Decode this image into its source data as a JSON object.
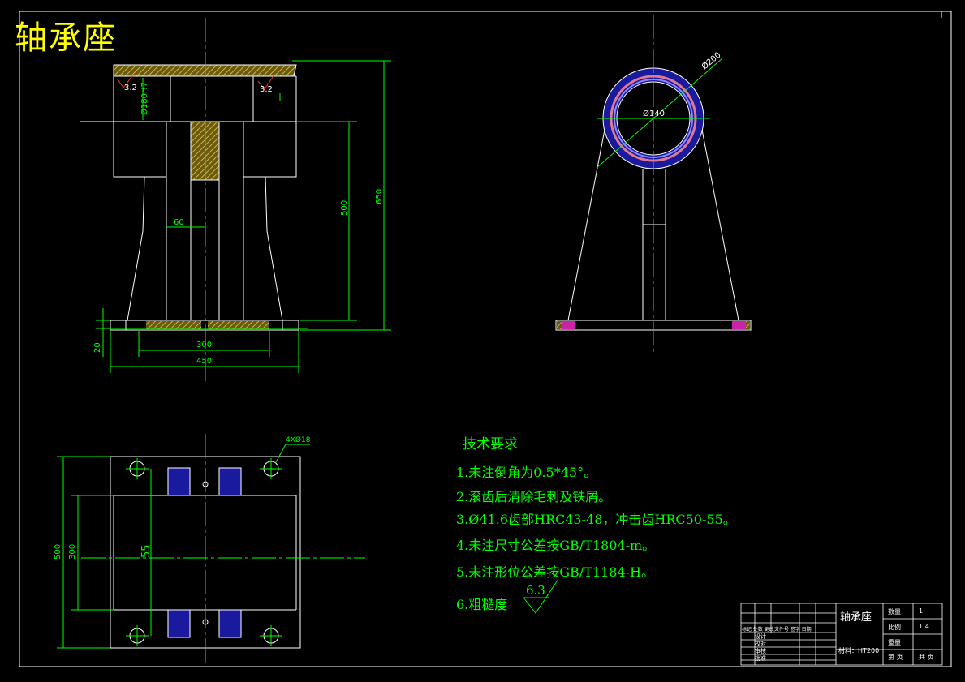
{
  "sheet": {
    "title": "轴承座"
  },
  "dimensions": {
    "d_bore": "Ø180H7",
    "rough_left": "3.2",
    "rough_right": "3.2",
    "width_60": "60",
    "height_500": "500",
    "height_650": "650",
    "base_20": "20",
    "span_300": "300",
    "span_450": "450",
    "outer_200": "Ø200",
    "inner_140": "Ø140",
    "holes": "4XØ18",
    "plan_500": "500",
    "plan_300": "300",
    "plan_55": "55"
  },
  "tech_requirements": {
    "title": "技术要求",
    "items": [
      "1.未注倒角为0.5*45°。",
      "2.滚齿后清除毛刺及铁屑。",
      "3.Ø41.6齿部HRC43-48，冲击齿HRC50-55。",
      "4.未注尺寸公差按GB/T1804-m。",
      "5.未注形位公差按GB/T1184-H。",
      "6.粗糙度"
    ],
    "roughness_value": "6.3"
  },
  "title_block": {
    "part_name": "轴承座",
    "qty_label": "数量",
    "qty_value": "1",
    "scale_label": "比例",
    "scale_value": "1:4",
    "weight_label": "重量",
    "material": "材料：HT200",
    "sheet_label": "第 页",
    "total_label": "共 页",
    "revision_headers": "标记 处数  更改文件号 签字 日期",
    "row_design": "设计",
    "row_check": "校对",
    "row_review": "审核",
    "row_approve": "批准"
  },
  "colors": {
    "background": "#000000",
    "outline": "#ffffff",
    "centerline": "#00ff00",
    "dimension": "#00ff00",
    "hatch": "#d4c24a",
    "fill_blue": "#1a1a9e",
    "fill_magenta": "#cc22aa",
    "title_text": "#ffff00"
  }
}
